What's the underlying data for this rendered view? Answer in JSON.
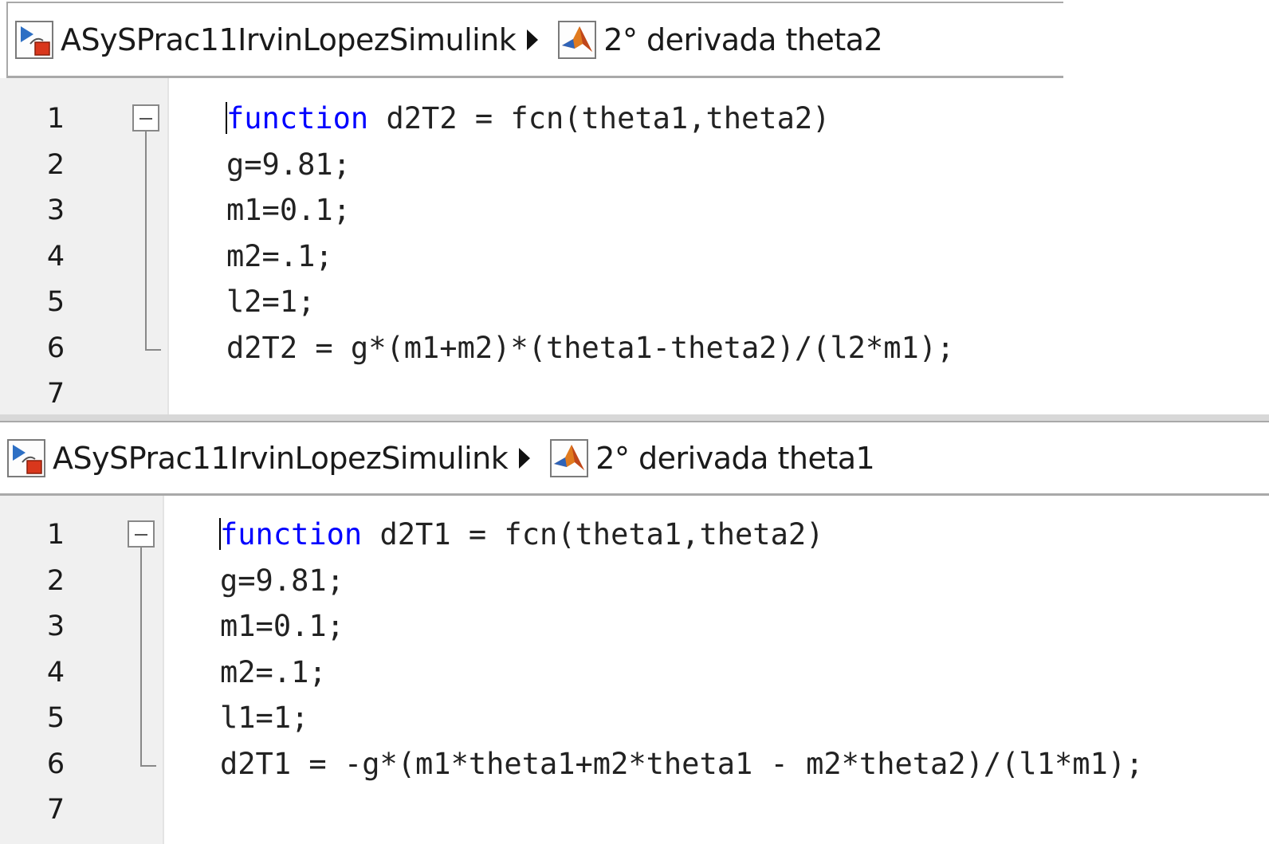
{
  "panels": [
    {
      "breadcrumb": {
        "model_name": "ASySPrac11IrvinLopezSimulink",
        "block_name": "2° derivada theta2"
      },
      "lines": [
        {
          "num": "1",
          "keyword": "function",
          "rest": " d2T2 = fcn(theta1,theta2)"
        },
        {
          "num": "2",
          "keyword": "",
          "rest": "g=9.81;"
        },
        {
          "num": "3",
          "keyword": "",
          "rest": "m1=0.1;"
        },
        {
          "num": "4",
          "keyword": "",
          "rest": "m2=.1;"
        },
        {
          "num": "5",
          "keyword": "",
          "rest": "l2=1;"
        },
        {
          "num": "6",
          "keyword": "",
          "rest": "d2T2 = g*(m1+m2)*(theta1-theta2)/(l2*m1);"
        },
        {
          "num": "7",
          "keyword": "",
          "rest": ""
        }
      ]
    },
    {
      "breadcrumb": {
        "model_name": "ASySPrac11IrvinLopezSimulink",
        "block_name": "2° derivada theta1"
      },
      "lines": [
        {
          "num": "1",
          "keyword": "function",
          "rest": " d2T1 = fcn(theta1,theta2)"
        },
        {
          "num": "2",
          "keyword": "",
          "rest": "g=9.81;"
        },
        {
          "num": "3",
          "keyword": "",
          "rest": "m1=0.1;"
        },
        {
          "num": "4",
          "keyword": "",
          "rest": "m2=.1;"
        },
        {
          "num": "5",
          "keyword": "",
          "rest": "l1=1;"
        },
        {
          "num": "6",
          "keyword": "",
          "rest": "d2T1 = -g*(m1*theta1+m2*theta1 - m2*theta2)/(l1*m1);"
        },
        {
          "num": "7",
          "keyword": "",
          "rest": ""
        }
      ]
    }
  ],
  "colors": {
    "keyword": "#0000ff",
    "gutter": "#f0f0f0",
    "text": "#222222"
  },
  "icons": {
    "model": "simulink-model-icon",
    "block": "matlab-function-icon",
    "separator": "triangle-right-icon",
    "fold": "fold-collapse-icon"
  }
}
